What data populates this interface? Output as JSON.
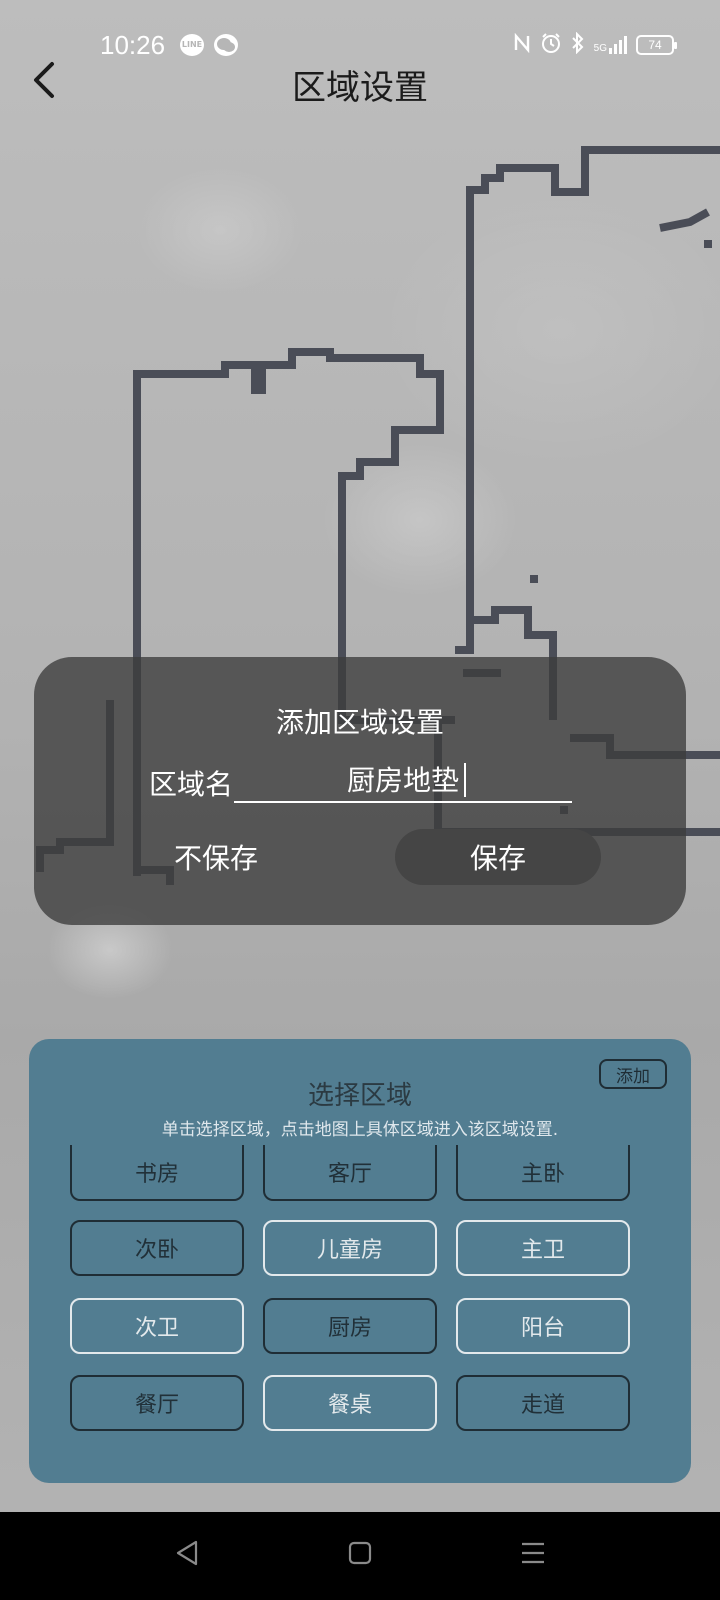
{
  "status_bar": {
    "time": "10:26",
    "app_icons": [
      "line-icon",
      "wechat-icon"
    ],
    "indicators": [
      "nfc-icon",
      "alarm-icon",
      "bluetooth-icon",
      "signal-icon",
      "battery-icon"
    ],
    "network_label": "5G",
    "battery_level": "74"
  },
  "header": {
    "back_icon": "chevron-left-icon",
    "title": "区域设置"
  },
  "dialog": {
    "title": "添加区域设置",
    "field_label": "区域名",
    "input_value": "厨房地垫",
    "cancel_label": "不保存",
    "save_label": "保存"
  },
  "area_panel": {
    "title": "选择区域",
    "add_label": "添加",
    "hint": "单击选择区域，点击地图上具体区域进入该区域设置.",
    "areas": [
      {
        "label": "书房",
        "style": "dark"
      },
      {
        "label": "客厅",
        "style": "dark"
      },
      {
        "label": "主卧",
        "style": "dark"
      },
      {
        "label": "次卧",
        "style": "dark"
      },
      {
        "label": "儿童房",
        "style": "light"
      },
      {
        "label": "主卫",
        "style": "light"
      },
      {
        "label": "次卫",
        "style": "light"
      },
      {
        "label": "厨房",
        "style": "dark"
      },
      {
        "label": "阳台",
        "style": "light"
      },
      {
        "label": "餐厅",
        "style": "dark"
      },
      {
        "label": "餐桌",
        "style": "light"
      },
      {
        "label": "走道",
        "style": "dark"
      }
    ]
  },
  "nav_bar": {
    "icons": [
      "back-triangle-icon",
      "home-square-icon",
      "menu-lines-icon"
    ]
  },
  "colors": {
    "panel": "#527d91",
    "dialog": "#3c3c3c",
    "map_wall": "#4a4d57",
    "background": "#b6b6b6"
  }
}
